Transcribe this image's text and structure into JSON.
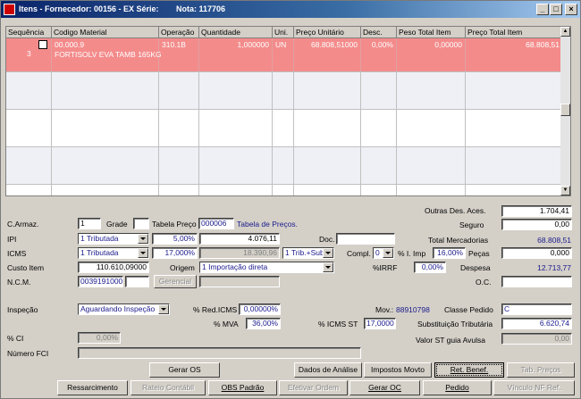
{
  "window": {
    "title_prefix": "Itens - Fornecedor: 00156 - EX Série:",
    "title_nota": "Nota: 117706",
    "min": "_",
    "max": "□",
    "close": "×"
  },
  "grid": {
    "columns": [
      "Sequência",
      "Codigo Material",
      "Operação",
      "Quantidade",
      "Uni.",
      "Preço Unitário",
      "Desc.",
      "Peso Total Item",
      "Preço Total Item"
    ],
    "row": {
      "sequencia": "3",
      "codigo": "00.000.9",
      "descricao": "FORTISOLV EVA TAMB 165KG",
      "operacao": "310.1B",
      "quantidade": "1,000000",
      "uni": "UN",
      "preco_unitario": "68.808,51000",
      "desc": "0,00%",
      "peso_total": "0,00000",
      "preco_total": "68.808,51"
    },
    "scroll_up": "▲",
    "scroll_down": "▼"
  },
  "form": {
    "carmaz_label": "C.Armaz.",
    "carmaz": "1",
    "grade_label": "Grade",
    "grade": "",
    "tabela_preco_label": "Tabela Preço",
    "tabela_preco": "000006",
    "tabela_preco_desc": "Tabela de Preços.",
    "ipi_label": "IPI",
    "ipi_sel": "1 Tributada",
    "ipi_pct": "5,00%",
    "ipi_val": "4.076,11",
    "doc_label": "Doc.",
    "doc": "",
    "icms_label": "ICMS",
    "icms_sel": "1 Tributada",
    "icms_pct": "17,000%",
    "icms_val": "18.390,96",
    "trib_sel": "1 Trib.+Subs",
    "compl_label": "Compl.",
    "compl_sel": "0",
    "i_imp_label": "% I. Imp",
    "i_imp": "16,00%",
    "custo_item_label": "Custo Item",
    "custo_item": "110.610,09000",
    "origem_label": "Origem",
    "origem_sel": "1 Importação direta",
    "irrf_label": "%IRRF",
    "irrf": "0,00%",
    "ncm_label": "N.C.M.",
    "ncm": "0039191000",
    "ncm2": "",
    "gerencial_label": "Gerencial",
    "gerencial": "",
    "inspecao_label": "Inspeção",
    "inspecao_sel": "Aguardando Inspeção",
    "red_icms_label": "% Red.ICMS",
    "red_icms": "0,00000%",
    "mov_label": "Mov.:",
    "mov": "88910798",
    "classe_pedido_label": "Classe Pedido",
    "classe_pedido": "C",
    "mva_label": "% MVA",
    "mva": "36,00%",
    "icms_st_label": "% ICMS ST",
    "icms_st": "17,0000",
    "subst_trib_label": "Substituição Tributária",
    "subst_trib": "6.620,74",
    "ci_label": "% CI",
    "ci": "0,00%",
    "valor_st_label": "Valor ST guia Avulsa",
    "valor_st": "0,00",
    "fci_label": "Número FCI",
    "fci": ""
  },
  "totals": {
    "outras_label": "Outras Des. Aces.",
    "outras": "1.704,41",
    "seguro_label": "Seguro",
    "seguro": "0,00",
    "total_merc_label": "Total Mercadorias",
    "total_merc": "68.808,51",
    "pecas_label": "Peças",
    "pecas": "0,000",
    "despesa_label": "Despesa",
    "despesa": "12.713,77",
    "oc_label": "O.C.",
    "oc": ""
  },
  "buttons": {
    "gerar_os": "Gerar OS",
    "dados_analise": "Dados de Análise",
    "impostos_movto": "Impostos Movto",
    "ret_benef": "Ret. Benef.",
    "tab_precos": "Tab. Preços",
    "ressarcimento": "Ressarcimento",
    "rateio_contabil": "Rateio Contábil",
    "obs_padrao": "OBS Padrão",
    "efetivar_ordem": "Efetivar Ordem",
    "gerar_oc": "Gerar OC",
    "pedido": "Pedido",
    "vinculo_nf": "Vínculo NF Ref."
  }
}
